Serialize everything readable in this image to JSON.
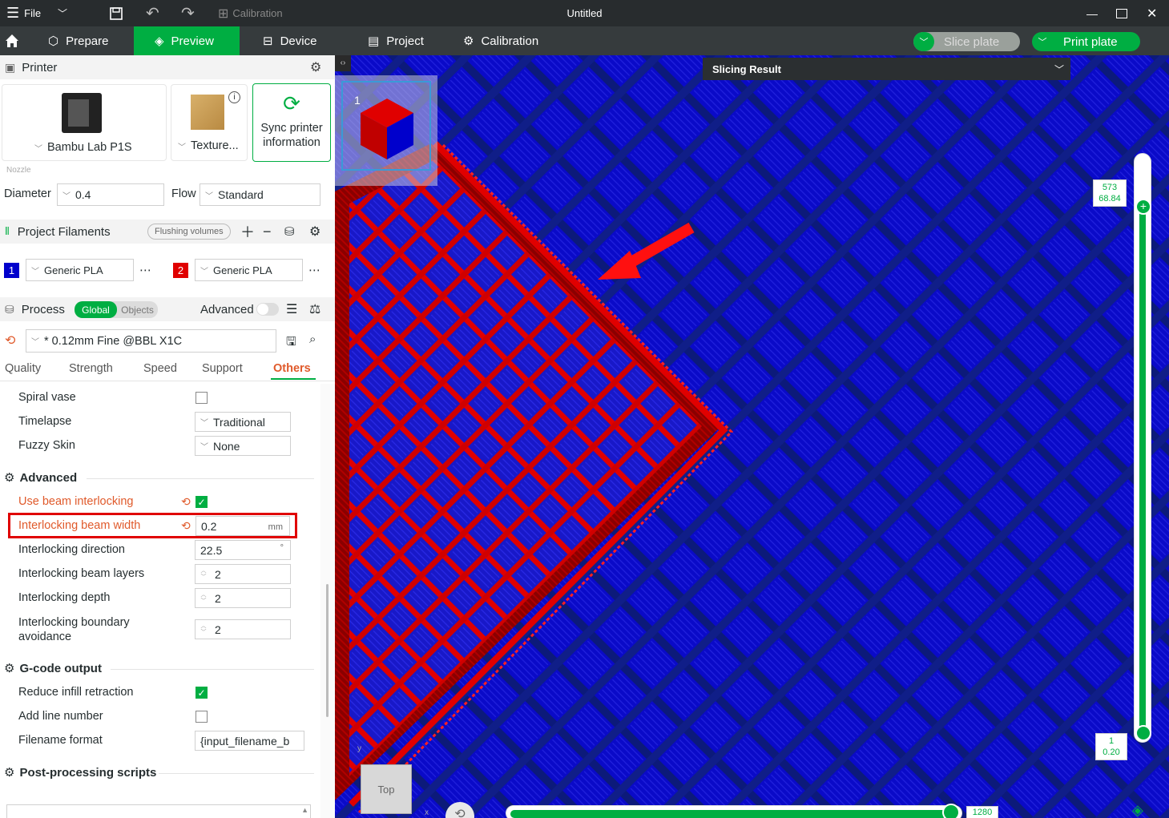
{
  "titlebar": {
    "file_label": "File",
    "calibration_label": "Calibration",
    "title": "Untitled"
  },
  "nav": {
    "prepare": "Prepare",
    "preview": "Preview",
    "device": "Device",
    "project": "Project",
    "calibration": "Calibration",
    "slice_plate": "Slice plate",
    "print_plate": "Print plate"
  },
  "printer": {
    "header": "Printer",
    "printer_name": "Bambu Lab P1S",
    "plate_name": "Texture...",
    "sync_line1": "Sync printer",
    "sync_line2": "information",
    "nozzle_label": "Nozzle",
    "diameter_label": "Diameter",
    "diameter_value": "0.4",
    "flow_label": "Flow",
    "flow_value": "Standard"
  },
  "filaments": {
    "header": "Project Filaments",
    "flushing_label": "Flushing volumes",
    "items": [
      {
        "index": "1",
        "name": "Generic PLA",
        "color": "#0000cc"
      },
      {
        "index": "2",
        "name": "Generic PLA",
        "color": "#e00000"
      }
    ]
  },
  "process": {
    "header": "Process",
    "global_label": "Global",
    "objects_label": "Objects",
    "advanced_label": "Advanced",
    "preset": "* 0.12mm Fine @BBL X1C",
    "tabs": [
      "Quality",
      "Strength",
      "Speed",
      "Support",
      "Others"
    ],
    "active_tab": "Others"
  },
  "settings": {
    "spiral_vase": "Spiral vase",
    "timelapse": "Timelapse",
    "timelapse_value": "Traditional",
    "fuzzy_skin": "Fuzzy Skin",
    "fuzzy_skin_value": "None",
    "advanced_header": "Advanced",
    "use_beam_interlocking": "Use beam interlocking",
    "interlocking_beam_width": "Interlocking beam width",
    "beam_width_value": "0.2",
    "beam_width_unit": "mm",
    "interlocking_direction": "Interlocking direction",
    "direction_value": "22.5",
    "direction_unit": "°",
    "interlocking_beam_layers": "Interlocking beam layers",
    "beam_layers_value": "2",
    "interlocking_depth": "Interlocking depth",
    "depth_value": "2",
    "boundary_avoidance_line1": "Interlocking boundary",
    "boundary_avoidance_line2": "avoidance",
    "boundary_value": "2",
    "gcode_header": "G-code output",
    "reduce_infill_retraction": "Reduce infill retraction",
    "add_line_number": "Add line number",
    "filename_format": "Filename format",
    "filename_format_value": "{input_filename_b",
    "post_processing_header": "Post-processing scripts"
  },
  "viewport": {
    "slicing_result": "Slicing Result",
    "plate_number": "1",
    "view_label": "Top",
    "axis_y": "y",
    "axis_x": "x",
    "layer_top_number": "573",
    "layer_top_height": "68.84",
    "layer_bottom_number": "1",
    "layer_bottom_height": "0.20",
    "move_value": "1280"
  }
}
